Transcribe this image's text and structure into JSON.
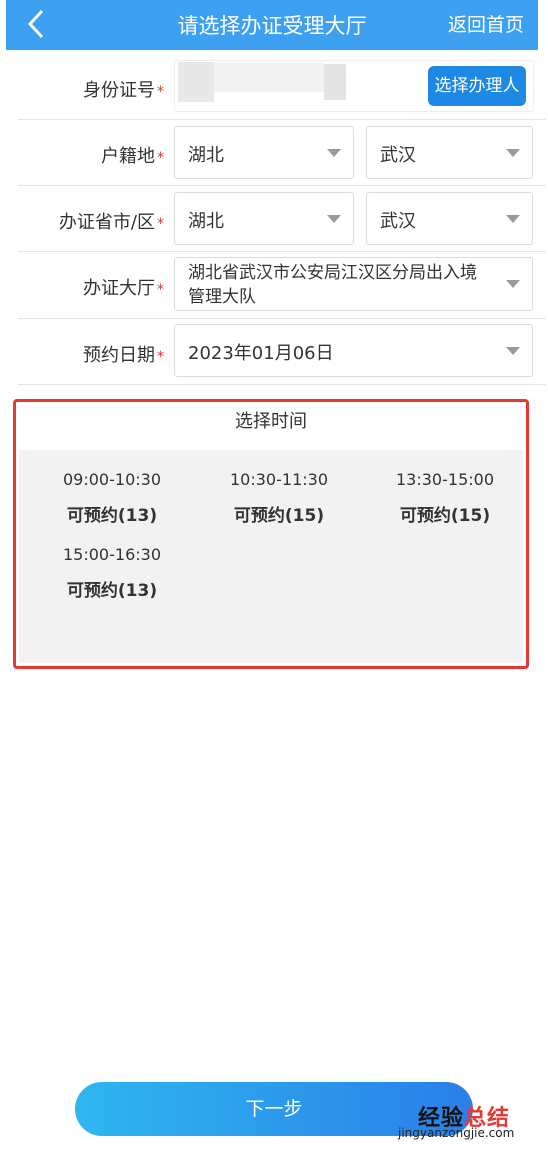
{
  "header": {
    "title": "请选择办证受理大厅",
    "home_label": "返回首页"
  },
  "form": {
    "id_label": "身份证号",
    "required_mark": "*",
    "choose_person_button": "选择办理人",
    "household_label": "户籍地",
    "household_province": "湖北",
    "household_city": "武汉",
    "office_region_label": "办证省市/区",
    "office_province": "湖北",
    "office_city": "武汉",
    "hall_label": "办证大厅",
    "hall_line1": "湖北省武汉市公安局江汉区分局出入境",
    "hall_line2": "管理大队",
    "date_label": "预约日期",
    "date_value": "2023年01月06日"
  },
  "time": {
    "title": "选择时间",
    "slots": [
      {
        "time": "09:00-10:30",
        "avail": "可预约(13)"
      },
      {
        "time": "10:30-11:30",
        "avail": "可预约(15)"
      },
      {
        "time": "13:30-15:00",
        "avail": "可预约(15)"
      },
      {
        "time": "15:00-16:30",
        "avail": "可预约(13)"
      }
    ]
  },
  "footer": {
    "next_label": "下一步"
  },
  "watermark": {
    "brand_a": "经验",
    "brand_b": "总结",
    "url": "jingyanzongjie.com"
  }
}
